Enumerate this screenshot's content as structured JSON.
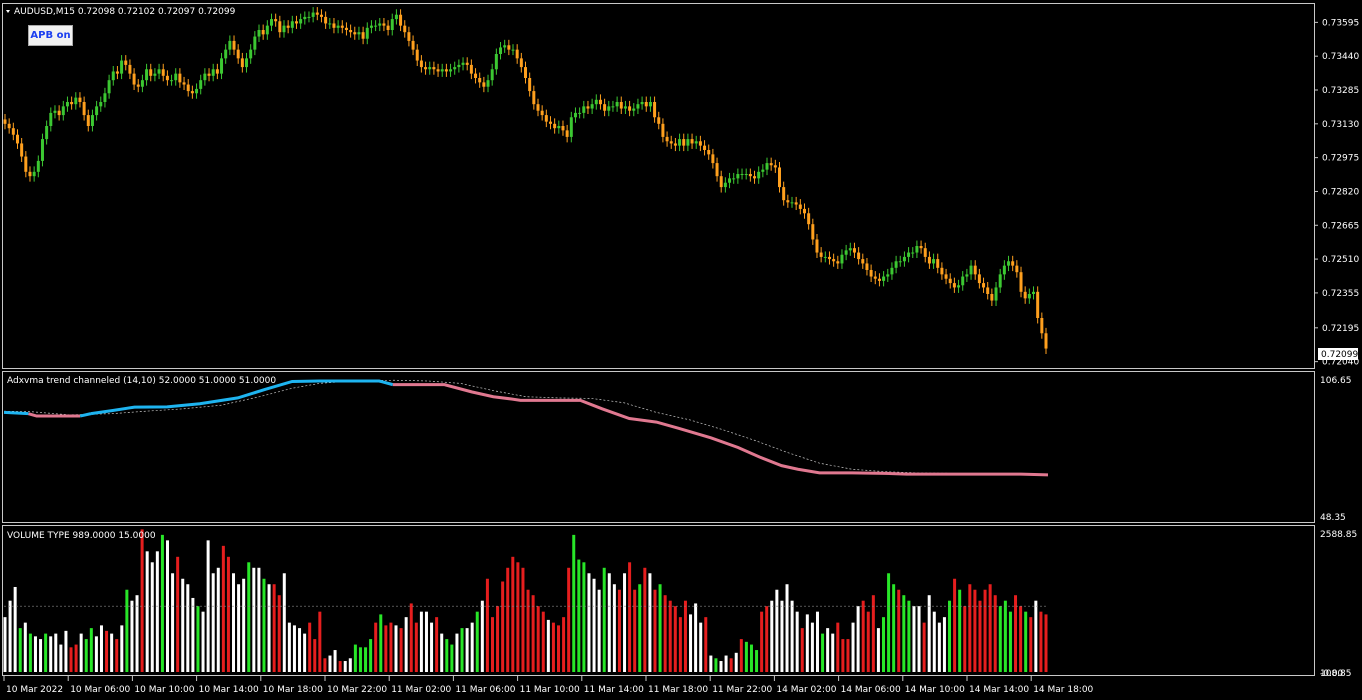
{
  "main_chart": {
    "symbol_line": "AUDUSD,M15  0.72098 0.72102 0.72097 0.72099",
    "button_label": "APB on",
    "price_ticks": [
      "0.73595",
      "0.73440",
      "0.73285",
      "0.73130",
      "0.72975",
      "0.72820",
      "0.72665",
      "0.72510",
      "0.72355",
      "0.72195",
      "0.72040"
    ],
    "current_price": "0.72099",
    "price_range": [
      0.7202,
      0.7367
    ],
    "bull_color": "#3cc832",
    "bear_color": "#ffa01e",
    "closes": [
      0.7313,
      0.7311,
      0.7308,
      0.7304,
      0.7298,
      0.7291,
      0.7289,
      0.7291,
      0.7296,
      0.7306,
      0.7312,
      0.7318,
      0.7319,
      0.7317,
      0.7321,
      0.7323,
      0.7322,
      0.7325,
      0.7323,
      0.7317,
      0.7312,
      0.7317,
      0.7321,
      0.7323,
      0.7327,
      0.7333,
      0.7337,
      0.7336,
      0.7342,
      0.734,
      0.7336,
      0.7331,
      0.733,
      0.7333,
      0.7338,
      0.7335,
      0.7336,
      0.7338,
      0.7335,
      0.7333,
      0.7333,
      0.7336,
      0.7332,
      0.7331,
      0.7328,
      0.7327,
      0.7329,
      0.7333,
      0.7336,
      0.7335,
      0.7338,
      0.7336,
      0.7343,
      0.7347,
      0.7351,
      0.7347,
      0.7343,
      0.7339,
      0.7343,
      0.7347,
      0.7353,
      0.7356,
      0.7354,
      0.7358,
      0.7361,
      0.736,
      0.7355,
      0.7358,
      0.7357,
      0.736,
      0.7359,
      0.7361,
      0.7362,
      0.7362,
      0.7364,
      0.7363,
      0.7362,
      0.7359,
      0.7359,
      0.7357,
      0.7358,
      0.7357,
      0.7356,
      0.7355,
      0.7354,
      0.7355,
      0.7352,
      0.7357,
      0.7358,
      0.7358,
      0.7359,
      0.7358,
      0.7356,
      0.7361,
      0.7363,
      0.7358,
      0.7355,
      0.7351,
      0.7347,
      0.7342,
      0.7339,
      0.7338,
      0.7339,
      0.7338,
      0.7337,
      0.7338,
      0.7337,
      0.7338,
      0.7339,
      0.734,
      0.7341,
      0.734,
      0.7336,
      0.7334,
      0.7332,
      0.733,
      0.7333,
      0.7338,
      0.7345,
      0.7348,
      0.7349,
      0.7347,
      0.7347,
      0.7343,
      0.7339,
      0.7334,
      0.7328,
      0.7322,
      0.7319,
      0.7317,
      0.7314,
      0.7313,
      0.7311,
      0.7312,
      0.731,
      0.7307,
      0.7316,
      0.7318,
      0.7318,
      0.7321,
      0.732,
      0.7322,
      0.7324,
      0.7322,
      0.7319,
      0.7321,
      0.7321,
      0.7323,
      0.732,
      0.7321,
      0.7319,
      0.732,
      0.7322,
      0.7323,
      0.7321,
      0.7323,
      0.7316,
      0.7313,
      0.7307,
      0.7305,
      0.7304,
      0.7303,
      0.7306,
      0.7303,
      0.7306,
      0.7304,
      0.7305,
      0.7303,
      0.7301,
      0.7299,
      0.7295,
      0.7289,
      0.7284,
      0.7286,
      0.7288,
      0.7288,
      0.729,
      0.729,
      0.729,
      0.7289,
      0.7288,
      0.7291,
      0.7292,
      0.7295,
      0.7294,
      0.7293,
      0.7284,
      0.7278,
      0.7277,
      0.7277,
      0.7276,
      0.7274,
      0.7272,
      0.7267,
      0.726,
      0.7254,
      0.7252,
      0.7252,
      0.7251,
      0.725,
      0.7249,
      0.7253,
      0.7255,
      0.7256,
      0.7254,
      0.7251,
      0.7249,
      0.7246,
      0.7243,
      0.7242,
      0.7241,
      0.7243,
      0.7244,
      0.7247,
      0.725,
      0.725,
      0.7252,
      0.7254,
      0.7254,
      0.7257,
      0.7256,
      0.7252,
      0.7249,
      0.7251,
      0.7247,
      0.7244,
      0.7242,
      0.724,
      0.7238,
      0.7239,
      0.7243,
      0.7244,
      0.7248,
      0.7244,
      0.724,
      0.7238,
      0.7235,
      0.7232,
      0.7238,
      0.7244,
      0.7248,
      0.725,
      0.7248,
      0.7245,
      0.7236,
      0.7233,
      0.7235,
      0.7236,
      0.7224,
      0.7217,
      0.721
    ]
  },
  "adx_pane": {
    "label": "Adxvma trend channeled (14,10) 52.0000 51.0000 51.0000",
    "max_label": "106.65",
    "min_label": "48.35",
    "range": [
      48.35,
      106.65
    ],
    "up_color": "#1eb4f0",
    "down_color": "#e07890",
    "dashed_color": "#c8c8c8",
    "line_points": [
      [
        0,
        92.0
      ],
      [
        0.045,
        91.5
      ],
      [
        0.06,
        90.5
      ],
      [
        0.14,
        90.5
      ],
      [
        0.16,
        91.5
      ],
      [
        0.2,
        92.8
      ],
      [
        0.24,
        94.2
      ],
      [
        0.3,
        94.3
      ],
      [
        0.36,
        95.6
      ],
      [
        0.43,
        98.0
      ],
      [
        0.48,
        101.5
      ],
      [
        0.53,
        104.8
      ],
      [
        0.58,
        105.0
      ],
      [
        0.69,
        105.0
      ],
      [
        0.715,
        103.5
      ],
      [
        0.76,
        103.5
      ],
      [
        0.81,
        103.5
      ],
      [
        0.86,
        100.5
      ],
      [
        0.9,
        98.5
      ],
      [
        0.935,
        97.5
      ],
      [
        0.95,
        97.0
      ],
      [
        1.0,
        97.0
      ],
      [
        1.06,
        97.0
      ],
      [
        1.1,
        93.5
      ],
      [
        1.15,
        89.5
      ],
      [
        1.2,
        88.0
      ],
      [
        1.24,
        85.5
      ],
      [
        1.3,
        81.5
      ],
      [
        1.35,
        77.5
      ],
      [
        1.39,
        73.5
      ],
      [
        1.43,
        70.0
      ],
      [
        1.46,
        68.5
      ],
      [
        1.5,
        67.0
      ],
      [
        1.56,
        67.0
      ],
      [
        1.62,
        66.8
      ],
      [
        1.66,
        66.5
      ],
      [
        1.82,
        66.5
      ],
      [
        1.87,
        66.5
      ],
      [
        1.92,
        66.2
      ]
    ],
    "up_until_index": 14,
    "dashed_points": [
      [
        0,
        92.5
      ],
      [
        0.05,
        92.3
      ],
      [
        0.12,
        91.0
      ],
      [
        0.2,
        91.5
      ],
      [
        0.26,
        92.5
      ],
      [
        0.33,
        93.5
      ],
      [
        0.4,
        95.0
      ],
      [
        0.47,
        98.5
      ],
      [
        0.53,
        102.0
      ],
      [
        0.58,
        104.0
      ],
      [
        0.65,
        105.2
      ],
      [
        0.72,
        105.3
      ],
      [
        0.78,
        105.0
      ],
      [
        0.84,
        104.0
      ],
      [
        0.9,
        101.0
      ],
      [
        0.96,
        98.5
      ],
      [
        1.02,
        98.0
      ],
      [
        1.08,
        97.8
      ],
      [
        1.14,
        96.0
      ],
      [
        1.2,
        92.0
      ],
      [
        1.26,
        89.0
      ],
      [
        1.32,
        85.0
      ],
      [
        1.38,
        80.5
      ],
      [
        1.44,
        75.5
      ],
      [
        1.5,
        71.0
      ],
      [
        1.56,
        68.5
      ],
      [
        1.62,
        67.5
      ],
      [
        1.68,
        67.0
      ],
      [
        1.75,
        66.8
      ],
      [
        1.82,
        66.7
      ],
      [
        1.92,
        66.6
      ]
    ]
  },
  "volume_pane": {
    "label": "VOLUME TYPE 989.0000 15.0000",
    "max_label": "2588.85",
    "min_label": "-0.00",
    "min_label_2": "108.85",
    "range": [
      0,
      2588.85
    ],
    "reference_level": 1200,
    "green": "#28e628",
    "red": "#e61e1e",
    "white": "#ffffff",
    "bars": [
      [
        1000,
        "w"
      ],
      [
        1300,
        "w"
      ],
      [
        1550,
        "w"
      ],
      [
        800,
        "g"
      ],
      [
        900,
        "w"
      ],
      [
        700,
        "g"
      ],
      [
        650,
        "w"
      ],
      [
        600,
        "w"
      ],
      [
        700,
        "g"
      ],
      [
        650,
        "w"
      ],
      [
        700,
        "w"
      ],
      [
        500,
        "w"
      ],
      [
        750,
        "w"
      ],
      [
        450,
        "r"
      ],
      [
        500,
        "r"
      ],
      [
        700,
        "w"
      ],
      [
        600,
        "g"
      ],
      [
        800,
        "g"
      ],
      [
        650,
        "w"
      ],
      [
        850,
        "w"
      ],
      [
        750,
        "r"
      ],
      [
        700,
        "w"
      ],
      [
        600,
        "r"
      ],
      [
        850,
        "w"
      ],
      [
        1500,
        "g"
      ],
      [
        1300,
        "w"
      ],
      [
        1400,
        "w"
      ],
      [
        2600,
        "r"
      ],
      [
        2200,
        "w"
      ],
      [
        2000,
        "w"
      ],
      [
        2200,
        "w"
      ],
      [
        2500,
        "g"
      ],
      [
        2400,
        "w"
      ],
      [
        1800,
        "w"
      ],
      [
        2100,
        "r"
      ],
      [
        1700,
        "w"
      ],
      [
        1600,
        "w"
      ],
      [
        1350,
        "w"
      ],
      [
        1200,
        "g"
      ],
      [
        1100,
        "w"
      ],
      [
        2400,
        "w"
      ],
      [
        1800,
        "w"
      ],
      [
        1900,
        "w"
      ],
      [
        2300,
        "r"
      ],
      [
        2100,
        "r"
      ],
      [
        1800,
        "w"
      ],
      [
        1600,
        "w"
      ],
      [
        1700,
        "w"
      ],
      [
        2000,
        "g"
      ],
      [
        1900,
        "w"
      ],
      [
        1900,
        "w"
      ],
      [
        1700,
        "g"
      ],
      [
        1600,
        "w"
      ],
      [
        1600,
        "r"
      ],
      [
        1400,
        "r"
      ],
      [
        1800,
        "w"
      ],
      [
        900,
        "w"
      ],
      [
        850,
        "w"
      ],
      [
        800,
        "w"
      ],
      [
        700,
        "w"
      ],
      [
        900,
        "r"
      ],
      [
        600,
        "r"
      ],
      [
        1100,
        "r"
      ],
      [
        250,
        "r"
      ],
      [
        300,
        "w"
      ],
      [
        400,
        "w"
      ],
      [
        200,
        "r"
      ],
      [
        200,
        "w"
      ],
      [
        250,
        "w"
      ],
      [
        500,
        "g"
      ],
      [
        450,
        "g"
      ],
      [
        450,
        "g"
      ],
      [
        600,
        "g"
      ],
      [
        900,
        "r"
      ],
      [
        1050,
        "g"
      ],
      [
        850,
        "r"
      ],
      [
        900,
        "r"
      ],
      [
        850,
        "w"
      ],
      [
        800,
        "r"
      ],
      [
        1000,
        "w"
      ],
      [
        1250,
        "r"
      ],
      [
        900,
        "r"
      ],
      [
        1100,
        "w"
      ],
      [
        1100,
        "w"
      ],
      [
        900,
        "w"
      ],
      [
        1000,
        "r"
      ],
      [
        700,
        "w"
      ],
      [
        600,
        "g"
      ],
      [
        500,
        "g"
      ],
      [
        700,
        "w"
      ],
      [
        800,
        "g"
      ],
      [
        800,
        "w"
      ],
      [
        900,
        "w"
      ],
      [
        1100,
        "g"
      ],
      [
        1300,
        "w"
      ],
      [
        1700,
        "r"
      ],
      [
        1000,
        "r"
      ],
      [
        1200,
        "r"
      ],
      [
        1650,
        "r"
      ],
      [
        1900,
        "r"
      ],
      [
        2100,
        "r"
      ],
      [
        2000,
        "r"
      ],
      [
        1900,
        "r"
      ],
      [
        1500,
        "r"
      ],
      [
        1400,
        "r"
      ],
      [
        1200,
        "r"
      ],
      [
        1100,
        "r"
      ],
      [
        950,
        "w"
      ],
      [
        900,
        "r"
      ],
      [
        850,
        "r"
      ],
      [
        1000,
        "r"
      ],
      [
        1900,
        "r"
      ],
      [
        2500,
        "g"
      ],
      [
        2050,
        "g"
      ],
      [
        2000,
        "g"
      ],
      [
        1800,
        "w"
      ],
      [
        1700,
        "w"
      ],
      [
        1500,
        "w"
      ],
      [
        1900,
        "g"
      ],
      [
        1800,
        "w"
      ],
      [
        1600,
        "w"
      ],
      [
        1500,
        "r"
      ],
      [
        1800,
        "w"
      ],
      [
        2000,
        "r"
      ],
      [
        1500,
        "r"
      ],
      [
        1600,
        "g"
      ],
      [
        1900,
        "r"
      ],
      [
        1800,
        "w"
      ],
      [
        1500,
        "r"
      ],
      [
        1600,
        "g"
      ],
      [
        1400,
        "r"
      ],
      [
        1300,
        "r"
      ],
      [
        1200,
        "r"
      ],
      [
        1000,
        "r"
      ],
      [
        1300,
        "r"
      ],
      [
        1050,
        "w"
      ],
      [
        1250,
        "w"
      ],
      [
        900,
        "w"
      ],
      [
        1000,
        "r"
      ],
      [
        300,
        "w"
      ],
      [
        250,
        "g"
      ],
      [
        200,
        "w"
      ],
      [
        300,
        "w"
      ],
      [
        250,
        "r"
      ],
      [
        350,
        "w"
      ],
      [
        600,
        "r"
      ],
      [
        550,
        "g"
      ],
      [
        500,
        "g"
      ],
      [
        400,
        "g"
      ],
      [
        1100,
        "r"
      ],
      [
        1200,
        "r"
      ],
      [
        1300,
        "w"
      ],
      [
        1500,
        "w"
      ],
      [
        1300,
        "w"
      ],
      [
        1600,
        "w"
      ],
      [
        1300,
        "w"
      ],
      [
        1100,
        "w"
      ],
      [
        800,
        "r"
      ],
      [
        1050,
        "w"
      ],
      [
        900,
        "w"
      ],
      [
        1100,
        "w"
      ],
      [
        700,
        "g"
      ],
      [
        800,
        "w"
      ],
      [
        700,
        "w"
      ],
      [
        900,
        "r"
      ],
      [
        600,
        "r"
      ],
      [
        600,
        "r"
      ],
      [
        900,
        "w"
      ],
      [
        1200,
        "w"
      ],
      [
        1300,
        "r"
      ],
      [
        1100,
        "r"
      ],
      [
        1400,
        "r"
      ],
      [
        800,
        "w"
      ],
      [
        1000,
        "g"
      ],
      [
        1800,
        "g"
      ],
      [
        1600,
        "g"
      ],
      [
        1500,
        "r"
      ],
      [
        1400,
        "g"
      ],
      [
        1300,
        "g"
      ],
      [
        1200,
        "w"
      ],
      [
        1200,
        "w"
      ],
      [
        900,
        "r"
      ],
      [
        1400,
        "w"
      ],
      [
        1100,
        "w"
      ],
      [
        900,
        "w"
      ],
      [
        1000,
        "w"
      ],
      [
        1300,
        "g"
      ],
      [
        1700,
        "r"
      ],
      [
        1500,
        "g"
      ],
      [
        1200,
        "r"
      ],
      [
        1600,
        "r"
      ],
      [
        1500,
        "r"
      ],
      [
        1300,
        "r"
      ],
      [
        1500,
        "r"
      ],
      [
        1600,
        "r"
      ],
      [
        1400,
        "r"
      ],
      [
        1200,
        "g"
      ],
      [
        1300,
        "g"
      ],
      [
        1100,
        "g"
      ],
      [
        1400,
        "r"
      ],
      [
        1200,
        "r"
      ],
      [
        1100,
        "g"
      ],
      [
        1000,
        "r"
      ],
      [
        1300,
        "w"
      ],
      [
        1100,
        "r"
      ],
      [
        1050,
        "r"
      ]
    ]
  },
  "time_axis": [
    "10 Mar 2022",
    "10 Mar 06:00",
    "10 Mar 10:00",
    "10 Mar 14:00",
    "10 Mar 18:00",
    "10 Mar 22:00",
    "11 Mar 02:00",
    "11 Mar 06:00",
    "11 Mar 10:00",
    "11 Mar 14:00",
    "11 Mar 18:00",
    "11 Mar 22:00",
    "14 Mar 02:00",
    "14 Mar 06:00",
    "14 Mar 10:00",
    "14 Mar 14:00",
    "14 Mar 18:00"
  ]
}
